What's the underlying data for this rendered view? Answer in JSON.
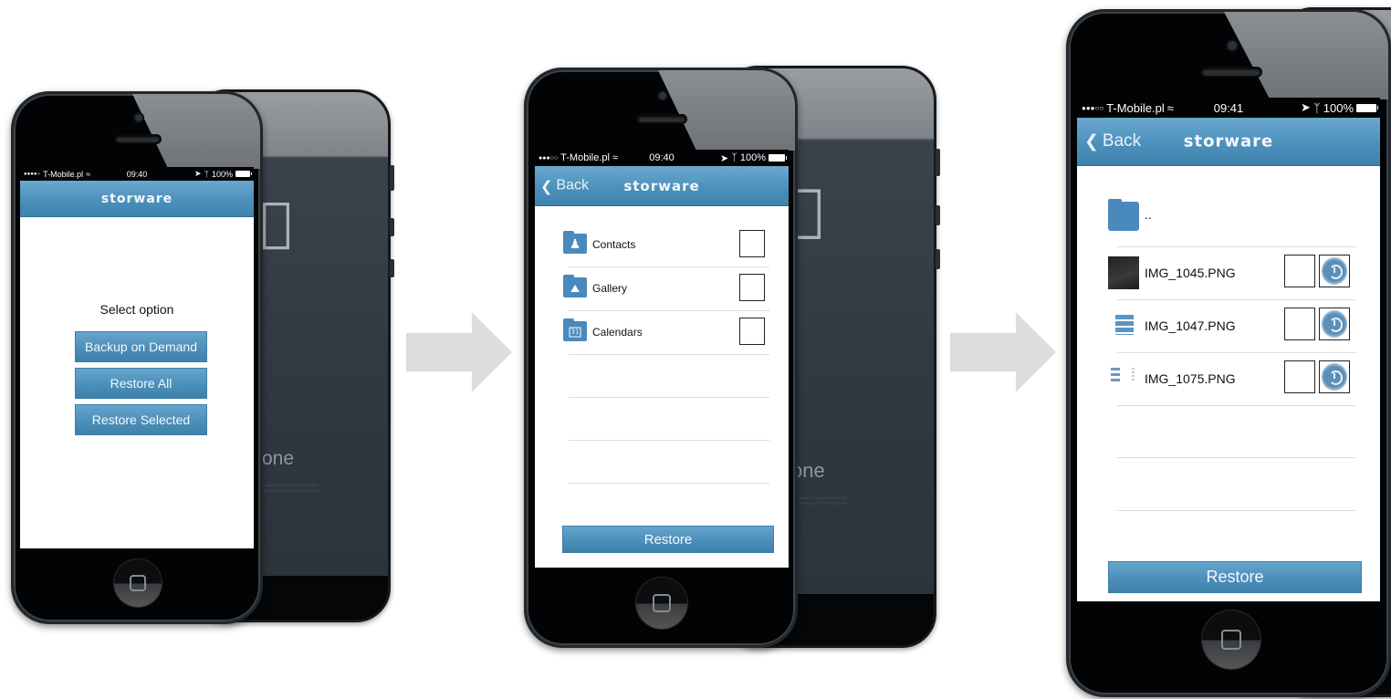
{
  "colors": {
    "brand_blue": "#4a8fba",
    "folder_blue": "#4a89bd",
    "arrow_gray": "#dcdcdc",
    "screen_bg": "#ffffff",
    "status_bar_bg": "#020304"
  },
  "device_back": {
    "model_text": "one",
    "fine_print": [
      "Assembled in China  Model A1428",
      "License: IN01-DC-01 KX00001019"
    ]
  },
  "screens": [
    {
      "status": {
        "carrier": "T-Mobile.pl",
        "signal": "●●●●○",
        "time": "09:40",
        "battery": "100%"
      },
      "navbar": {
        "brand": "storware"
      },
      "body": {
        "heading": "Select option",
        "buttons": [
          {
            "label": "Backup on Demand"
          },
          {
            "label": "Restore All"
          },
          {
            "label": "Restore Selected"
          }
        ]
      }
    },
    {
      "status": {
        "carrier": "T-Mobile.pl",
        "signal": "●●●○○",
        "time": "09:40",
        "battery": "100%"
      },
      "navbar": {
        "brand": "storware",
        "back_label": "Back"
      },
      "body": {
        "items": [
          {
            "label": "Contacts",
            "icon": "contacts-folder-icon",
            "checked": false
          },
          {
            "label": "Gallery",
            "icon": "gallery-folder-icon",
            "checked": false
          },
          {
            "label": "Calendars",
            "icon": "calendar-folder-icon",
            "checked": false,
            "icon_text": "31"
          }
        ],
        "restore_label": "Restore"
      }
    },
    {
      "status": {
        "carrier": "T-Mobile.pl",
        "signal": "●●●○○",
        "time": "09:41",
        "battery": "100%"
      },
      "navbar": {
        "brand": "storware",
        "back_label": "Back"
      },
      "body": {
        "parent_folder_label": "..",
        "files": [
          {
            "name": "IMG_1045.PNG",
            "thumb": "dark-screenshot",
            "checked": false
          },
          {
            "name": "IMG_1047.PNG",
            "thumb": "blue-buttons-screenshot",
            "checked": false
          },
          {
            "name": "IMG_1075.PNG",
            "thumb": "list-screenshot",
            "checked": false
          }
        ],
        "restore_label": "Restore"
      }
    }
  ],
  "flow_arrows": [
    {
      "icon": "right-arrow-icon"
    },
    {
      "icon": "right-arrow-icon"
    }
  ]
}
